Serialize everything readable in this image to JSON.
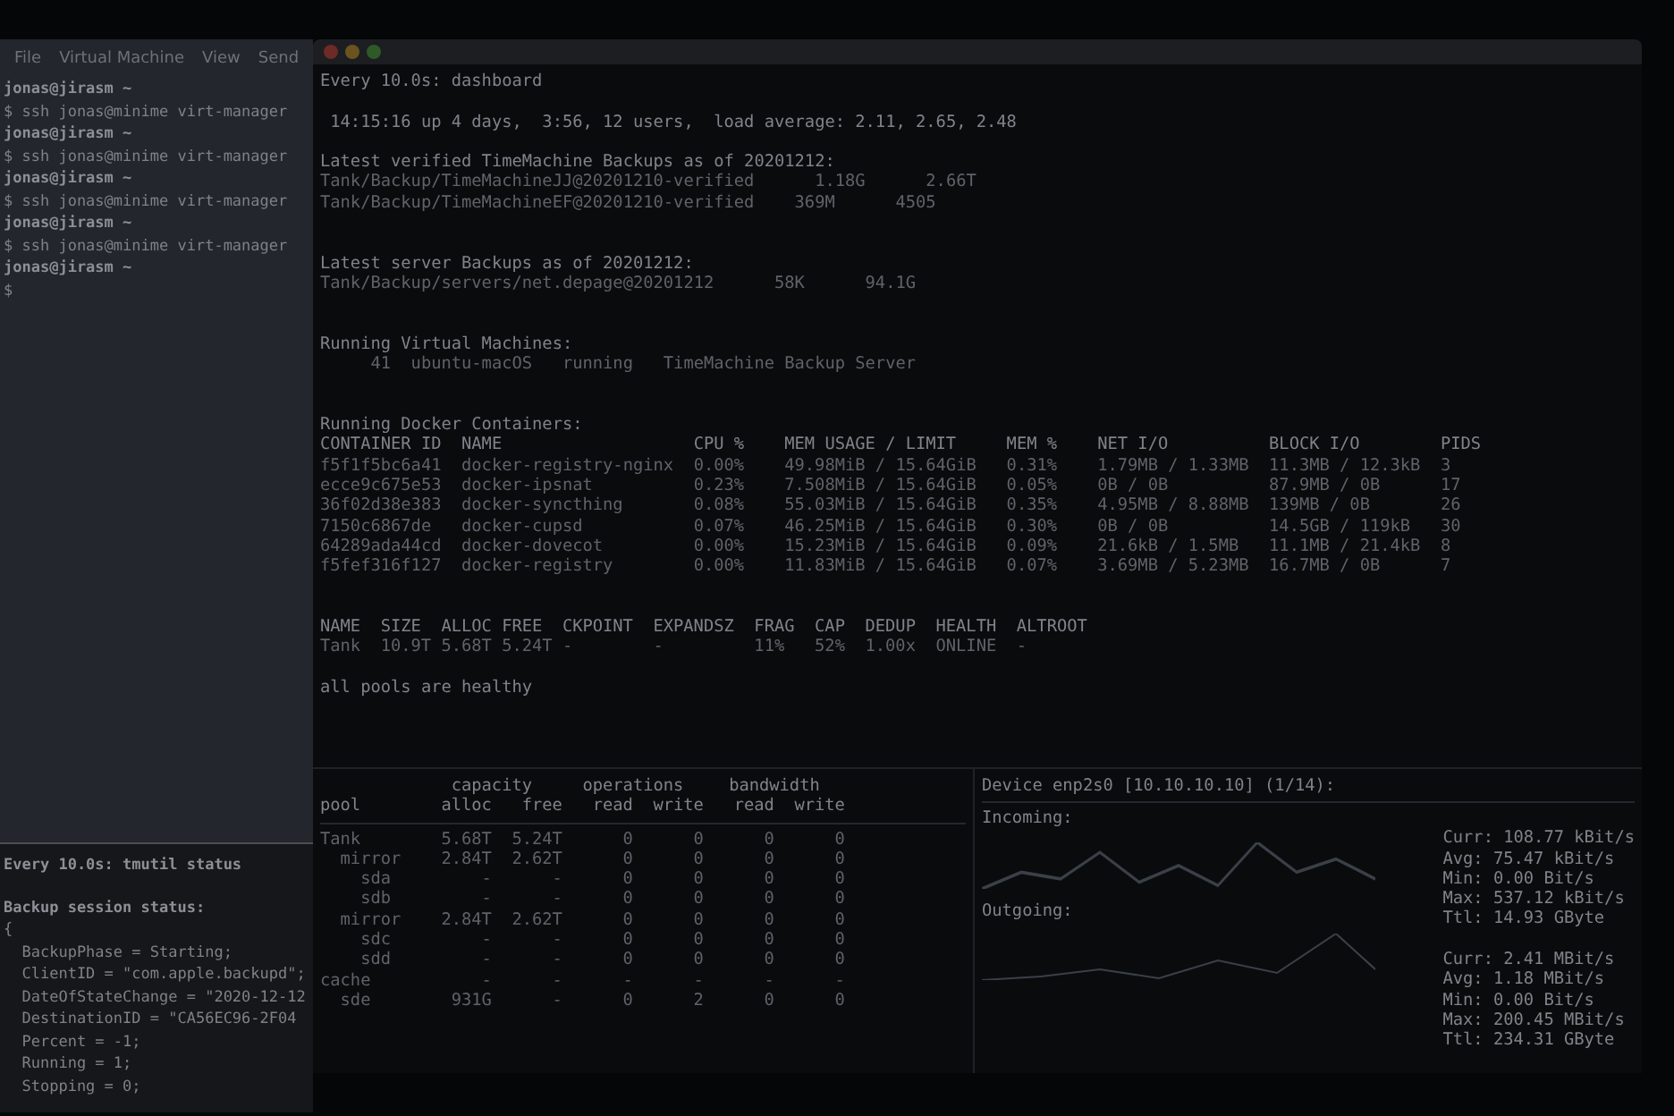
{
  "background_window": {
    "menu": [
      "File",
      "Virtual Machine",
      "View",
      "Send"
    ],
    "prompt_lines": [
      {
        "kind": "user",
        "text": "jonas@jirasm ~"
      },
      {
        "kind": "command",
        "text": "$ ssh jonas@minime virt-manager"
      },
      {
        "kind": "user",
        "text": "jonas@jirasm ~"
      },
      {
        "kind": "command",
        "text": "$ ssh jonas@minime virt-manager"
      },
      {
        "kind": "user",
        "text": "jonas@jirasm ~"
      },
      {
        "kind": "command",
        "text": "$ ssh jonas@minime virt-manager"
      },
      {
        "kind": "user",
        "text": "jonas@jirasm ~"
      },
      {
        "kind": "command",
        "text": "$ ssh jonas@minime virt-manager"
      },
      {
        "kind": "user",
        "text": "jonas@jirasm ~"
      },
      {
        "kind": "command",
        "text": "$"
      }
    ],
    "status_header": "Every 10.0s: tmutil status",
    "status_lines": [
      "Backup session status:",
      "{",
      "  BackupPhase = Starting;",
      "  ClientID = \"com.apple.backupd\";",
      "  DateOfStateChange = \"2020-12-12",
      "  DestinationID = \"CA56EC96-2F04",
      "  Percent = -1;",
      "  Running = 1;",
      "  Stopping = 0;"
    ]
  },
  "window": {
    "header": "Every 10.0s: dashboard",
    "uptime": " 14:15:16 up 4 days,  3:56, 12 users,  load average: 2.11, 2.65, 2.48",
    "sections": [
      {
        "title": "Latest verified TimeMachine Backups as of 20201212:",
        "lines": [
          "Tank/Backup/TimeMachineJJ@20201210-verified      1.18G      2.66T",
          "Tank/Backup/TimeMachineEF@20201210-verified    369M      4505"
        ]
      },
      {
        "title": "Latest server Backups as of 20201212:",
        "lines": [
          "Tank/Backup/servers/net.depage@20201212      58K      94.1G"
        ]
      },
      {
        "title": "Running Virtual Machines:",
        "lines": [
          "     41  ubuntu-macOS   running   TimeMachine Backup Server"
        ]
      }
    ],
    "docker": {
      "title": "Running Docker Containers:",
      "columns": [
        "CONTAINER ID",
        "NAME",
        "CPU %",
        "MEM USAGE / LIMIT",
        "MEM %",
        "NET I/O",
        "BLOCK I/O",
        "PIDS"
      ],
      "rows": [
        [
          "f5f1f5bc6a41",
          "docker-registry-nginx",
          "0.00%",
          "49.98MiB / 15.64GiB",
          "0.31%",
          "1.79MB / 1.33MB",
          "11.3MB / 12.3kB",
          "3"
        ],
        [
          "ecce9c675e53",
          "docker-ipsnat",
          "0.23%",
          "7.508MiB / 15.64GiB",
          "0.05%",
          "0B / 0B",
          "87.9MB / 0B",
          "17"
        ],
        [
          "36f02d38e383",
          "docker-syncthing",
          "0.08%",
          "55.03MiB / 15.64GiB",
          "0.35%",
          "4.95MB / 8.88MB",
          "139MB / 0B",
          "26"
        ],
        [
          "7150c6867de",
          "docker-cupsd",
          "0.07%",
          "46.25MiB / 15.64GiB",
          "0.30%",
          "0B / 0B",
          "14.5GB / 119kB",
          "30"
        ],
        [
          "64289ada44cd",
          "docker-dovecot",
          "0.00%",
          "15.23MiB / 15.64GiB",
          "0.09%",
          "21.6kB / 1.5MB",
          "11.1MB / 21.4kB",
          "8"
        ],
        [
          "f5fef316f127",
          "docker-registry",
          "0.00%",
          "11.83MiB / 15.64GiB",
          "0.07%",
          "3.69MB / 5.23MB",
          "16.7MB / 0B",
          "7"
        ]
      ]
    },
    "pools": {
      "columns": [
        "NAME",
        "SIZE",
        "ALLOC",
        "FREE",
        "CKPOINT",
        "EXPANDSZ",
        "FRAG",
        "CAP",
        "DEDUP",
        "HEALTH",
        "ALTROOT"
      ],
      "rows": [
        [
          "Tank",
          "10.9T",
          "5.68T",
          "5.24T",
          "-",
          "-",
          "11%",
          "52%",
          "1.00x",
          "ONLINE",
          "-"
        ]
      ],
      "status": "all pools are healthy"
    },
    "iostat": {
      "groups": [
        "capacity",
        "operations",
        "bandwidth"
      ],
      "columns": [
        "pool",
        "alloc",
        "free",
        "read",
        "write",
        "read",
        "write"
      ],
      "rows": [
        {
          "cells": [
            "Tank",
            "5.68T",
            "5.24T",
            "0",
            "0",
            "0",
            "0"
          ],
          "children": [
            {
              "cells": [
                "mirror",
                "2.84T",
                "2.62T",
                "0",
                "0",
                "0",
                "0"
              ],
              "children": [
                {
                  "cells": [
                    "sda",
                    "-",
                    "-",
                    "0",
                    "0",
                    "0",
                    "0"
                  ]
                },
                {
                  "cells": [
                    "sdb",
                    "-",
                    "-",
                    "0",
                    "0",
                    "0",
                    "0"
                  ]
                }
              ]
            },
            {
              "cells": [
                "mirror",
                "2.84T",
                "2.62T",
                "0",
                "0",
                "0",
                "0"
              ],
              "children": [
                {
                  "cells": [
                    "sdc",
                    "-",
                    "-",
                    "0",
                    "0",
                    "0",
                    "0"
                  ]
                },
                {
                  "cells": [
                    "sdd",
                    "-",
                    "-",
                    "0",
                    "0",
                    "0",
                    "0"
                  ]
                }
              ]
            }
          ]
        },
        {
          "cells": [
            "cache",
            "-",
            "-",
            "-",
            "-",
            "-",
            "-"
          ],
          "children": [
            {
              "cells": [
                "sde",
                "931G",
                "-",
                "0",
                "2",
                "0",
                "0"
              ]
            }
          ]
        }
      ]
    },
    "nload": {
      "device": "Device enp2s0 [10.10.10.10] (1/14):",
      "incoming": {
        "label": "Incoming:",
        "stats": [
          "Curr: 108.77 kBit/s",
          "Avg: 75.47 kBit/s",
          "Min: 0.00 Bit/s",
          "Max: 537.12 kBit/s",
          "Ttl: 14.93 GByte"
        ]
      },
      "outgoing": {
        "label": "Outgoing:",
        "stats": [
          "Curr: 2.41 MBit/s",
          "Avg: 1.18 MBit/s",
          "Min: 0.00 Bit/s",
          "Max: 200.45 MBit/s",
          "Ttl: 234.31 GByte"
        ]
      }
    }
  }
}
